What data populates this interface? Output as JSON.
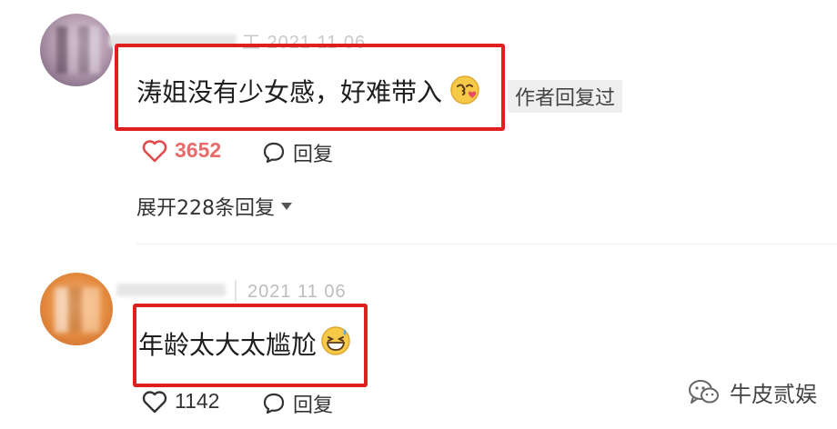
{
  "comments": [
    {
      "text": "涛姐没有少女感，好难带入",
      "author_tag": "作者回复过",
      "likes": "3652",
      "reply_label": "回复",
      "expand_label": "展开228条回复"
    },
    {
      "date": "2021 11 06",
      "text": "年龄太大太尴尬",
      "likes": "1142",
      "reply_label": "回复"
    }
  ],
  "watermark": {
    "label": "牛皮贰娱"
  },
  "colors": {
    "highlight": "#e0201f",
    "like_active": "#e04b4b"
  },
  "icons": [
    "heart-icon",
    "comment-bubble-icon",
    "caret-down-icon",
    "wechat-icon",
    "emoji-kiss-icon",
    "emoji-grin-sweat-icon"
  ]
}
